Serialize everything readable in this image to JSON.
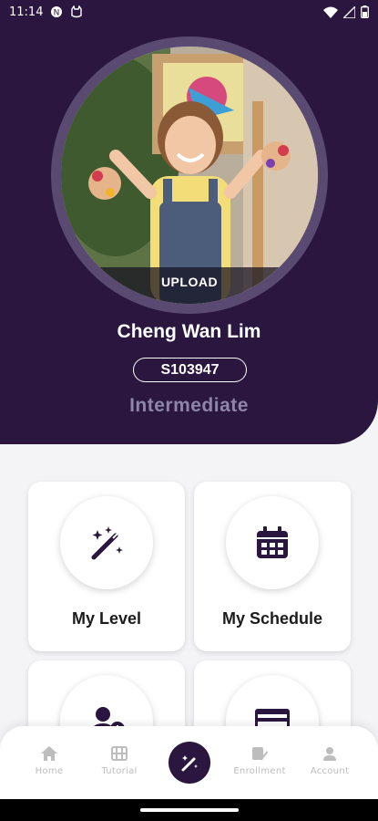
{
  "status_bar": {
    "time": "11:14",
    "left_icons": [
      "notification-icon",
      "cat-icon"
    ],
    "right_icons": [
      "wifi-icon",
      "signal-icon",
      "battery-icon"
    ]
  },
  "profile": {
    "upload_label": "UPLOAD",
    "name": "Cheng Wan Lim",
    "student_id": "S103947",
    "level": "Intermediate"
  },
  "tiles": [
    {
      "label": "My Level",
      "icon": "magic-wand-icon"
    },
    {
      "label": "My Schedule",
      "icon": "calendar-icon"
    },
    {
      "label": "",
      "icon": "add-user-icon"
    },
    {
      "label": "",
      "icon": "card-icon"
    }
  ],
  "bottom_nav": {
    "items": [
      {
        "label": "Home",
        "icon": "home-icon"
      },
      {
        "label": "Tutorial",
        "icon": "film-icon"
      },
      {
        "label": "",
        "icon": "magic-wand-icon",
        "active": true
      },
      {
        "label": "Enrollment",
        "icon": "enrollment-icon"
      },
      {
        "label": "Account",
        "icon": "account-icon"
      }
    ]
  },
  "colors": {
    "primary": "#2a163f",
    "ring": "#5a4a72",
    "level_text": "#8e86a8",
    "background": "#f4f3f5",
    "nav_inactive": "#bdbdbd"
  }
}
